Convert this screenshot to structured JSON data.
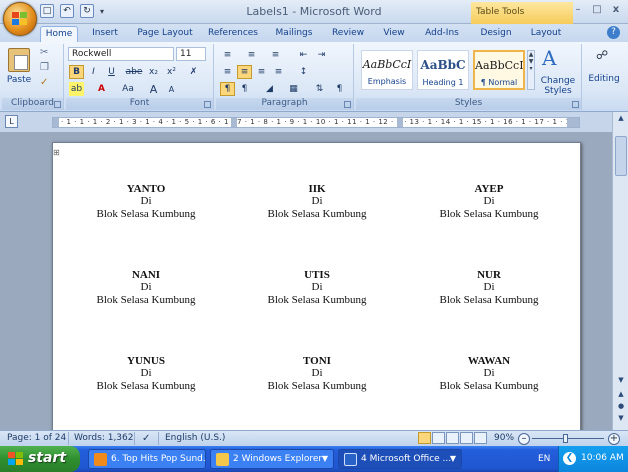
{
  "window": {
    "title": "Labels1 - Microsoft Word",
    "contextual_tools": "Table Tools",
    "min": "–",
    "max": "□",
    "close": "x"
  },
  "qat": [
    "save-icon",
    "undo-icon",
    "redo-icon"
  ],
  "tabs": [
    {
      "label": "Home",
      "active": true
    },
    {
      "label": "Insert"
    },
    {
      "label": "Page Layout"
    },
    {
      "label": "References"
    },
    {
      "label": "Mailings"
    },
    {
      "label": "Review"
    },
    {
      "label": "View"
    },
    {
      "label": "Add-Ins"
    },
    {
      "label": "Design"
    },
    {
      "label": "Layout"
    }
  ],
  "ribbon": {
    "clipboard": {
      "label": "Clipboard",
      "paste": "Paste"
    },
    "font": {
      "label": "Font",
      "name": "Rockwell",
      "size": "11",
      "bold": "B",
      "italic": "I",
      "underline": "U",
      "strike": "abe",
      "sub": "x₂",
      "sup": "x²",
      "aa": "Aa",
      "grow": "A",
      "shrink": "A"
    },
    "paragraph": {
      "label": "Paragraph",
      "pilcrow": "¶"
    },
    "styles": {
      "label": "Styles",
      "items": [
        {
          "sample": "AaBbCcI",
          "name": "Emphasis"
        },
        {
          "sample": "AaBbC",
          "name": "Heading 1"
        },
        {
          "sample": "AaBbCcI",
          "name": "¶ Normal"
        }
      ],
      "change": "Change Styles"
    },
    "editing": {
      "label": "Editing"
    }
  },
  "ruler": {
    "text": "· 1 · 1 · 1 · 2 · 1 · 3 · 1 · 4 · 1 · 5 · 1 · 6 · 1 · 7 · 1 · 8 · 1 · 9 · 1 · 10 · 1 · 11 · 1 · 12 · 1 · 13 · 1 · 14 · 1 · 15 · 1 · 16 · 1 · 17 · 1 · 18 · 1 · 19 ·"
  },
  "labels": [
    {
      "name": "YANTO",
      "di": "Di",
      "addr": "Blok Selasa Kumbung"
    },
    {
      "name": "IIK",
      "di": "Di",
      "addr": "Blok Selasa Kumbung"
    },
    {
      "name": "AYEP",
      "di": "Di",
      "addr": "Blok Selasa Kumbung"
    },
    {
      "name": "NANI",
      "di": "Di",
      "addr": "Blok Selasa Kumbung"
    },
    {
      "name": "UTIS",
      "di": "Di",
      "addr": "Blok Selasa Kumbung"
    },
    {
      "name": "NUR",
      "di": "Di",
      "addr": "Blok Selasa Kumbung"
    },
    {
      "name": "YUNUS",
      "di": "Di",
      "addr": "Blok Selasa Kumbung"
    },
    {
      "name": "TONI",
      "di": "Di",
      "addr": "Blok Selasa Kumbung"
    },
    {
      "name": "WAWAN",
      "di": "Di",
      "addr": "Blok Selasa Kumbung"
    }
  ],
  "status": {
    "page": "Page: 1 of 24",
    "words": "Words: 1,362",
    "language": "English (U.S.)",
    "zoom": "90%"
  },
  "taskbar": {
    "start": "start",
    "tasks": [
      "6. Top Hits Pop Sund...",
      "2 Windows Explorer",
      "4 Microsoft Office ..."
    ],
    "lang": "EN",
    "clock": "10:06 AM"
  },
  "colors": {
    "accent": "#15428b",
    "taskbar": "#245edb",
    "start": "#2f8f2f",
    "selected_style": "#f0b54a"
  }
}
